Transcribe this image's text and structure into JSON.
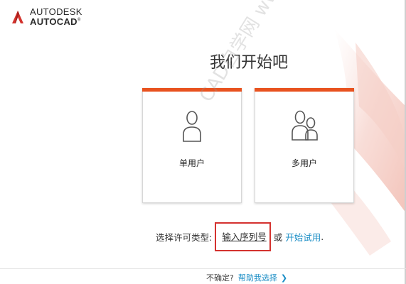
{
  "brand": {
    "line1": "AUTODESK",
    "line2": "AUTOCAD",
    "reg_mark": "®"
  },
  "heading": "我们开始吧",
  "cards": {
    "single": {
      "label": "单用户",
      "icon": "single-user-icon"
    },
    "multi": {
      "label": "多用户",
      "icon": "multi-user-icon"
    }
  },
  "license": {
    "prefix": "选择许可类型:",
    "serial_link": "输入序列号",
    "or_text": "或",
    "trial_link": "开始试用",
    "trailing": "."
  },
  "footer": {
    "question": "不确定?",
    "help_link": "帮助我选择",
    "chevron": "❯"
  },
  "watermark": "CAD自学网 www.cadzxw.com",
  "colors": {
    "accent_orange": "#e8521f",
    "link_blue": "#1b8ec6",
    "highlight_red": "#d4322f"
  }
}
